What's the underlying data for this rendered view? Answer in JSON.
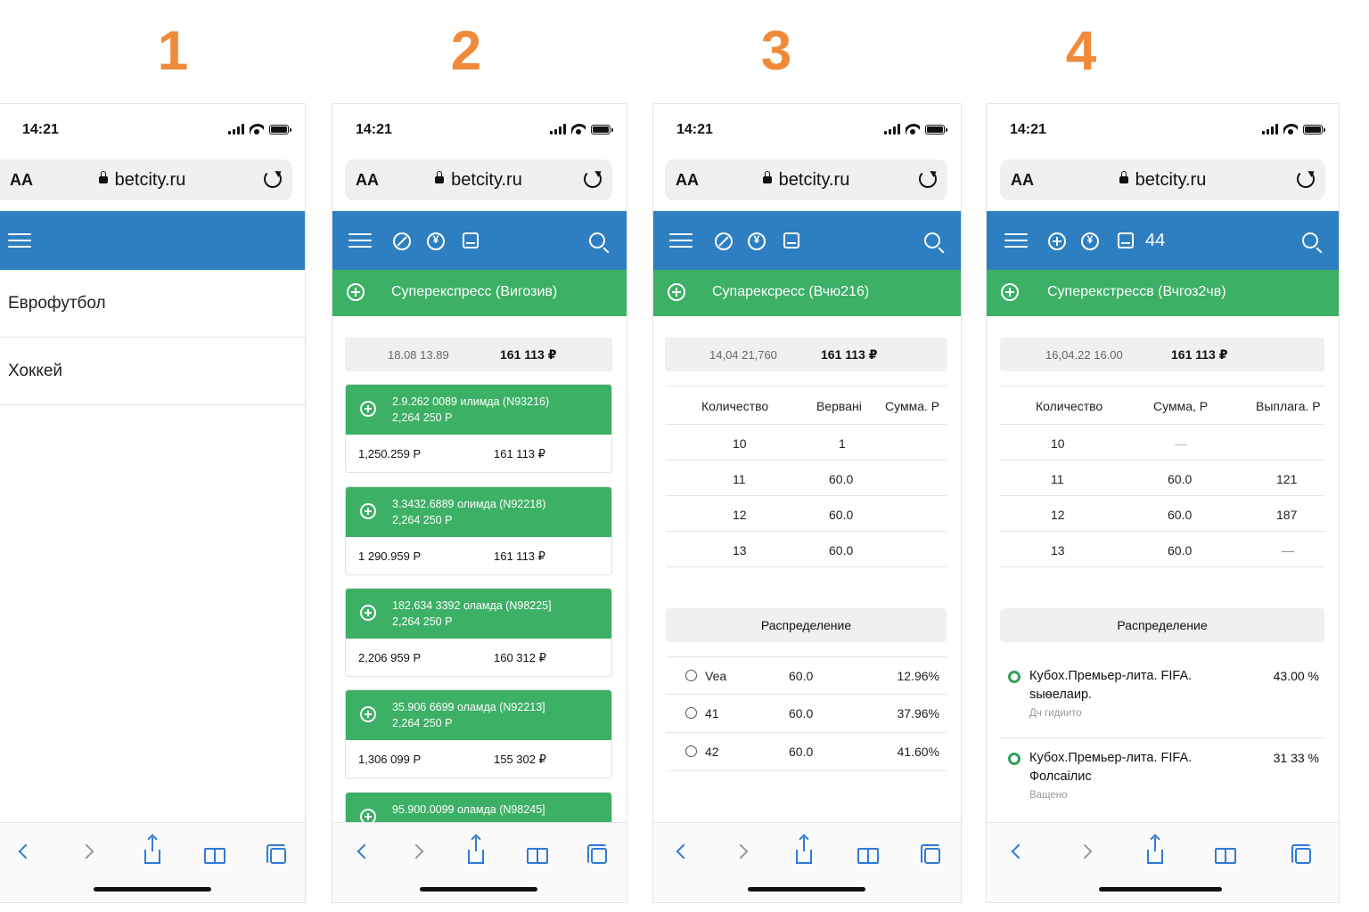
{
  "step_numbers": [
    "1",
    "2",
    "3",
    "4"
  ],
  "colors": {
    "accent_orange": "#ef8a3a",
    "nav_blue": "#2e7fc2",
    "green": "#3cb065",
    "ios_blue": "#2f7bd6"
  },
  "status": {
    "time": "14:21"
  },
  "browser": {
    "aa": "AA",
    "domain": "betcity.ru"
  },
  "icons": {
    "menu": "hamburger-icon",
    "live": "slash-circle-icon",
    "currency": "yen-circle-icon",
    "coupon": "document-icon",
    "plus": "plus-circle-icon",
    "search": "search-icon",
    "back": "chevron-left-icon",
    "forward": "chevron-right-icon",
    "share": "share-icon",
    "bookmarks": "book-icon",
    "tabs": "tabs-icon"
  },
  "screen1": {
    "menu_items": [
      "Еврофутбол",
      "Хоккей"
    ]
  },
  "screen2": {
    "banner": "Суперекспресс (Вигозив)",
    "summary": {
      "date": "18.08 13.89",
      "amount": "161 113 ₽"
    },
    "cards": [
      {
        "line1": "2.9.262 0089 илимда (N93216)",
        "line2": "2,264 250 Р",
        "v1": "1,250.259 Р",
        "v2": "161 113 ₽"
      },
      {
        "line1": "3.3432.6889 олимда (N92218)",
        "line2": "2,264 250 Р",
        "v1": "1 290.959 Р",
        "v2": "161 113 ₽"
      },
      {
        "line1": "182.634 3392 оламда (N98225]",
        "line2": "2,264 250 Р",
        "v1": "2,206 959 Р",
        "v2": "160 312 ₽"
      },
      {
        "line1": "35.906 6699 оламда (N92213]",
        "line2": "2,264 250 Р",
        "v1": "1,306 099 Р",
        "v2": "155 302 ₽"
      },
      {
        "line1": "95.900.0099 оламда (N98245]",
        "line2": "",
        "v1": "",
        "v2": ""
      }
    ]
  },
  "screen3": {
    "banner": "Супарексресс (Вчю216)",
    "summary": {
      "date": "14,04 21,760",
      "amount": "161 113 ₽"
    },
    "table": {
      "headers": [
        "Количество",
        "Вервані",
        "Сумма. Р"
      ],
      "rows": [
        [
          "10",
          "1",
          ""
        ],
        [
          "11",
          "60.0",
          ""
        ],
        [
          "12",
          "60.0",
          ""
        ],
        [
          "13",
          "60.0",
          ""
        ]
      ]
    },
    "distribution_label": "Распределение",
    "options": [
      {
        "name": "Vea",
        "value": "60.0",
        "pct": "12.96%"
      },
      {
        "name": "41",
        "value": "60.0",
        "pct": "37.96%"
      },
      {
        "name": "42",
        "value": "60.0",
        "pct": "41.60%"
      }
    ]
  },
  "screen4": {
    "banner": "Суперекстрессв (Вчгоз2чв)",
    "badge": "44",
    "summary": {
      "date": "16,04.22 16.00",
      "amount": "161 113 ₽"
    },
    "table": {
      "headers": [
        "Количество",
        "Сумма, Р",
        "Выплага. Р"
      ],
      "rows": [
        [
          "10",
          "—",
          ""
        ],
        [
          "11",
          "60.0",
          "121"
        ],
        [
          "12",
          "60.0",
          "187"
        ],
        [
          "13",
          "60.0",
          "—"
        ]
      ]
    },
    "distribution_label": "Распределение",
    "matches": [
      {
        "line1": "Кубох.Премьер-лита. FIFA.",
        "line2": "ѕыѳелаир.",
        "line3": "Дч гидиито",
        "pct": "43.00 %"
      },
      {
        "line1": "Кубох.Премьер-лита. FIFA.",
        "line2": "Фолсаілис",
        "line3": "Ващено",
        "pct": "31 33 %"
      }
    ]
  }
}
